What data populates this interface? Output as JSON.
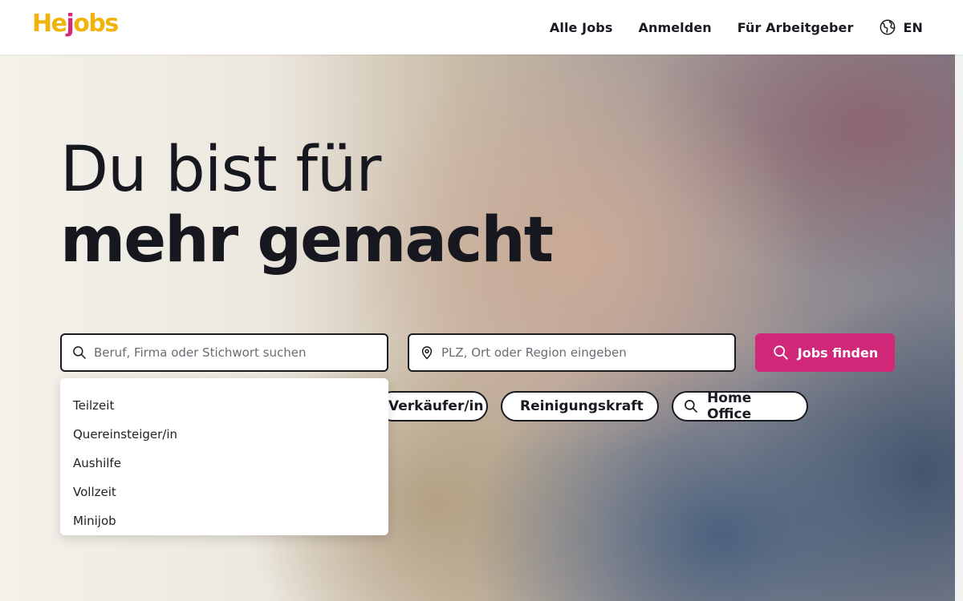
{
  "header": {
    "logo": {
      "part1": "He",
      "part2": "j",
      "part3": "obs"
    },
    "nav": [
      {
        "label": "Alle Jobs"
      },
      {
        "label": "Anmelden"
      },
      {
        "label": "Für Arbeitgeber"
      }
    ],
    "language": {
      "label": "EN",
      "icon": "globe-icon"
    }
  },
  "hero": {
    "headline_line1": "Du bist für",
    "headline_line2": "mehr gemacht"
  },
  "search": {
    "keyword_placeholder": "Beruf, Firma oder Stichwort suchen",
    "location_placeholder": "PLZ, Ort oder Region eingeben",
    "submit_label": "Jobs finden"
  },
  "suggestions": [
    {
      "label": "Teilzeit"
    },
    {
      "label": "Quereinsteiger/in"
    },
    {
      "label": "Aushilfe"
    },
    {
      "label": "Vollzeit"
    },
    {
      "label": "Minijob"
    }
  ],
  "chips": [
    {
      "label": "Verkäufer/in"
    },
    {
      "label": "Reinigungskraft"
    },
    {
      "label": "Home Office"
    }
  ],
  "colors": {
    "brand_yellow": "#f0b30a",
    "brand_pink": "#d1287a",
    "text_dark": "#1a1a22"
  }
}
